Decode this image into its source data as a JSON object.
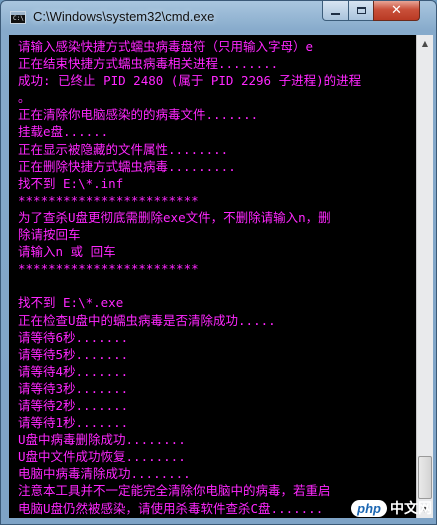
{
  "window": {
    "title": "C:\\Windows\\system32\\cmd.exe",
    "icon": "cmd-icon",
    "icon_text": "C:\\"
  },
  "console": {
    "text_color": "#ff27ff",
    "background": "#000000",
    "lines": [
      "请输入感染快捷方式蠕虫病毒盘符（只用输入字母）e",
      "正在结束快捷方式蠕虫病毒相关进程........",
      "成功: 已终止 PID 2480 (属于 PID 2296 子进程)的进程",
      "。",
      "正在清除你电脑感染的的病毒文件.......",
      "挂载e盘......",
      "正在显示被隐藏的文件属性........",
      "正在删除快捷方式蠕虫病毒.........",
      "找不到 E:\\*.inf",
      "************************",
      "为了查杀U盘更彻底需删除exe文件，不删除请输入n，删",
      "除请按回车",
      "请输入n 或 回车",
      "************************",
      "",
      "找不到 E:\\*.exe",
      "正在检查U盘中的蠕虫病毒是否清除成功.....",
      "请等待6秒.......",
      "请等待5秒.......",
      "请等待4秒.......",
      "请等待3秒.......",
      "请等待2秒.......",
      "请等待1秒.......",
      "U盘中病毒删除成功........",
      "U盘中文件成功恢复........",
      "电脑中病毒清除成功........",
      "注意本工具并不一定能完全清除你电脑中的病毒，若重启",
      "电脑U盘仍然被感染，请使用杀毒软件查杀C盘......."
    ]
  },
  "watermark": {
    "badge": "php",
    "text": "中文网"
  }
}
